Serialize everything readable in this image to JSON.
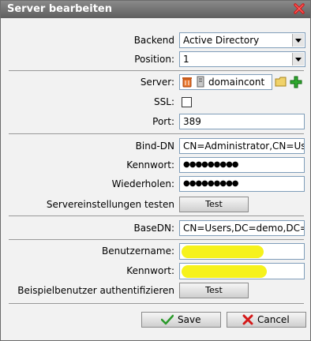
{
  "dialog": {
    "title": "Server bearbeiten"
  },
  "form": {
    "backend_label": "Backend",
    "backend_value": "Active Directory",
    "position_label": "Position:",
    "position_value": "1",
    "server_label": "Server:",
    "server_value": "domaincont",
    "ssl_label": "SSL:",
    "port_label": "Port:",
    "port_value": "389",
    "binddn_label": "Bind-DN",
    "binddn_value": "CN=Administrator,CN=Users",
    "password_label": "Kennwort:",
    "password_value": "●●●●●●●●●",
    "repeat_label": "Wiederholen:",
    "repeat_value": "●●●●●●●●●",
    "test_settings_label": "Servereinstellungen testen",
    "test_button": "Test",
    "basedn_label": "BaseDN:",
    "basedn_value": "CN=Users,DC=demo,DC=re",
    "username_label": "Benutzername:",
    "user_password_label": "Kennwort:",
    "auth_test_label": "Beispielbenutzer authentifizieren",
    "auth_test_button": "Test"
  },
  "footer": {
    "save_label": "Save",
    "cancel_label": "Cancel"
  },
  "colors": {
    "highlight": "#f6f21c",
    "title_bar": "#6e6e6e"
  }
}
